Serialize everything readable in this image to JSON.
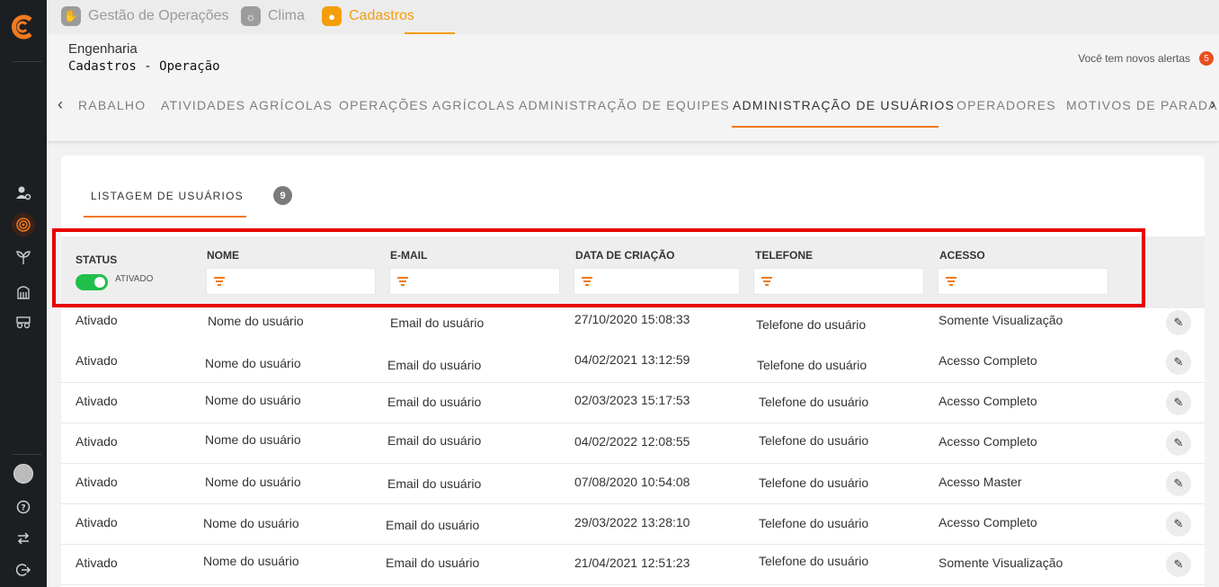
{
  "top_modules": [
    {
      "label": "Gestão de Operações",
      "icon": "hand-icon"
    },
    {
      "label": "Clima",
      "icon": "sun-icon"
    },
    {
      "label": "Cadastros",
      "icon": "user-icon"
    }
  ],
  "header": {
    "supertitle": "Engenharia",
    "title": "Cadastros - Operação",
    "alerts_text": "Você tem novos alertas",
    "alerts_count": "5"
  },
  "tabs": [
    "RABALHO",
    "ATIVIDADES AGRÍCOLAS",
    "OPERAÇÕES AGRÍCOLAS",
    "ADMINISTRAÇÃO DE EQUIPES",
    "ADMINISTRAÇÃO DE USUÁRIOS",
    "OPERADORES",
    "MOTIVOS DE PARADA"
  ],
  "active_tab": "ADMINISTRAÇÃO DE USUÁRIOS",
  "listing": {
    "label": "LISTAGEM DE USUÁRIOS",
    "count": "9"
  },
  "columns": {
    "status": "STATUS",
    "name": "NOME",
    "email": "E-MAIL",
    "created": "DATA DE CRIAÇÃO",
    "phone": "TELEFONE",
    "access": "ACESSO"
  },
  "status_toggle_label": "ATIVADO",
  "rows": [
    {
      "status": "Ativado",
      "name": "Nome do usuário",
      "email": "Email do usuário",
      "created": "27/10/2020 15:08:33",
      "phone": "Telefone do usuário",
      "access": "Somente Visualização"
    },
    {
      "status": "Ativado",
      "name": "Nome do usuário",
      "email": "Email do usuário",
      "created": "04/02/2021 13:12:59",
      "phone": "Telefone do usuário",
      "access": "Acesso Completo"
    },
    {
      "status": "Ativado",
      "name": "Nome do usuário",
      "email": "Email do usuário",
      "created": "02/03/2023 15:17:53",
      "phone": "Telefone do usuário",
      "access": "Acesso Completo"
    },
    {
      "status": "Ativado",
      "name": "Nome do usuário",
      "email": "Email do usuário",
      "created": "04/02/2022 12:08:55",
      "phone": "Telefone do usuário",
      "access": "Acesso Completo"
    },
    {
      "status": "Ativado",
      "name": "Nome do usuário",
      "email": "Email do usuário",
      "created": "07/08/2020 10:54:08",
      "phone": "Telefone do usuário",
      "access": "Acesso Master"
    },
    {
      "status": "Ativado",
      "name": "Nome do usuário",
      "email": "Email do usuário",
      "created": "29/03/2022 13:28:10",
      "phone": "Telefone do usuário",
      "access": "Acesso Completo"
    },
    {
      "status": "Ativado",
      "name": "Nome do usuário",
      "email": "Email do usuário",
      "created": "21/04/2021 12:51:23",
      "phone": "Telefone do usuário",
      "access": "Somente Visualização"
    }
  ],
  "colors": {
    "accent": "#f07a1e",
    "module_active": "#f59e0b",
    "highlight": "#e80000",
    "toggle_on": "#1fbf4b",
    "sidebar_bg": "#1c1f22"
  },
  "sidebar_icons": [
    "user-settings-icon",
    "target-icon",
    "plant-icon",
    "silo-icon",
    "tractor-icon",
    "help-icon",
    "switch-icon",
    "logout-icon"
  ]
}
